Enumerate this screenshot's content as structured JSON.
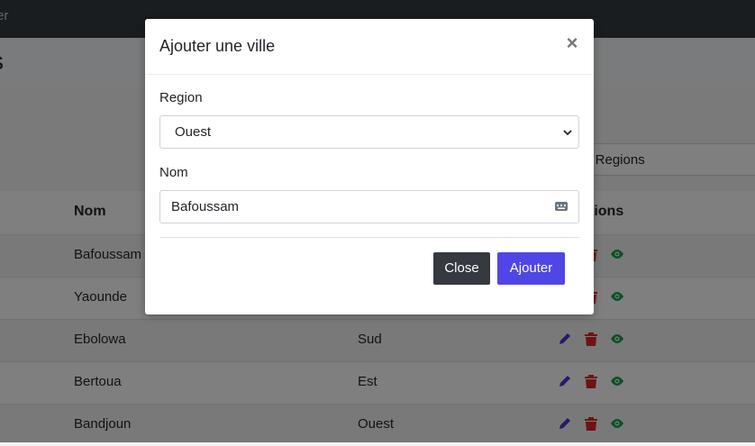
{
  "topbar": {
    "text": "er"
  },
  "page": {
    "heading": "s"
  },
  "filter": {
    "label": "s Regions"
  },
  "table": {
    "headers": {
      "name": "Nom",
      "actions": "tions"
    },
    "rows": [
      {
        "name": "Bafoussam",
        "region": ""
      },
      {
        "name": "Yaounde",
        "region": ""
      },
      {
        "name": "Ebolowa",
        "region": "Sud"
      },
      {
        "name": "Bertoua",
        "region": "Est"
      },
      {
        "name": "Bandjoun",
        "region": "Ouest"
      }
    ]
  },
  "modal": {
    "title": "Ajouter une ville",
    "close_symbol": "×",
    "region_label": "Region",
    "region_value": "Ouest",
    "nom_label": "Nom",
    "nom_value": "Bafoussam",
    "close_button": "Close",
    "add_button": "Ajouter"
  },
  "colors": {
    "edit": "#4338ca",
    "delete": "#dc2626",
    "view": "#16a34a",
    "primary": "#4f46e5",
    "dark": "#343a40"
  },
  "icons": [
    "pencil-icon",
    "trash-icon",
    "eye-icon",
    "chevron-down-icon",
    "keyboard-icon"
  ]
}
